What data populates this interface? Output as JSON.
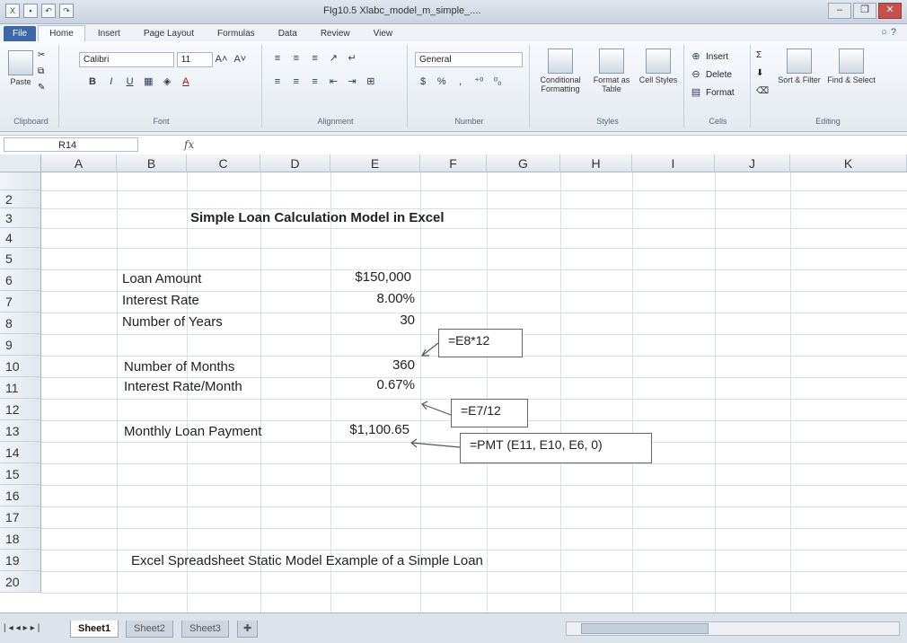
{
  "window": {
    "title": "FIg10.5 Xlabc_model_m_simple_....",
    "controls": [
      "–",
      "❐",
      "✕"
    ]
  },
  "ribbon_tabs": [
    "File",
    "Home",
    "Insert",
    "Page Layout",
    "Formulas",
    "Data",
    "Review",
    "View"
  ],
  "ribbon": {
    "clipboard": {
      "paste": "Paste",
      "label": "Clipboard"
    },
    "font": {
      "name": "Calibri",
      "size": "11",
      "label": "Font",
      "bold": "B",
      "italic": "I",
      "underline": "U"
    },
    "alignment": {
      "label": "Alignment"
    },
    "number": {
      "format": "General",
      "dollar": "$",
      "percent": "%",
      "comma": ",",
      "label": "Number"
    },
    "styles": {
      "conditional": "Conditional Formatting",
      "format_table": "Format as Table",
      "cell_styles": "Cell Styles",
      "label": "Styles"
    },
    "cells": {
      "insert": "Insert",
      "delete": "Delete",
      "format": "Format",
      "label": "Cells"
    },
    "editing": {
      "sort": "Sort & Filter",
      "find": "Find & Select",
      "label": "Editing"
    }
  },
  "formula_bar": {
    "name_box": "R14",
    "fx": "fx",
    "value": ""
  },
  "columns": [
    "A",
    "B",
    "C",
    "D",
    "E",
    "F",
    "G",
    "H",
    "I",
    "J",
    "K"
  ],
  "rows": [
    "2",
    "3",
    "4",
    "5",
    "6",
    "7",
    "8",
    "9",
    "10",
    "11",
    "12",
    "13",
    "14",
    "15",
    "16",
    "17",
    "18",
    "19",
    "20"
  ],
  "sheet": {
    "title": "Simple Loan Calculation Model in Excel",
    "labels": {
      "loan_amount": "Loan Amount",
      "interest_rate": "Interest Rate",
      "years": "Number of Years",
      "months": "Number of Months",
      "rate_month": "Interest Rate/Month",
      "payment": "Monthly Loan Payment"
    },
    "values": {
      "loan_amount": "$150,000",
      "interest_rate": "8.00%",
      "years": "30",
      "months": "360",
      "rate_month": "0.67%",
      "payment": "$1,100.65"
    },
    "footer": "Excel Spreadsheet Static Model Example of a Simple Loan"
  },
  "callouts": {
    "months": "=E8*12",
    "rate_month": "=E7/12",
    "payment": "=PMT (E11, E10, E6, 0)"
  },
  "sheet_tabs": [
    "Sheet1",
    "Sheet2",
    "Sheet3"
  ]
}
